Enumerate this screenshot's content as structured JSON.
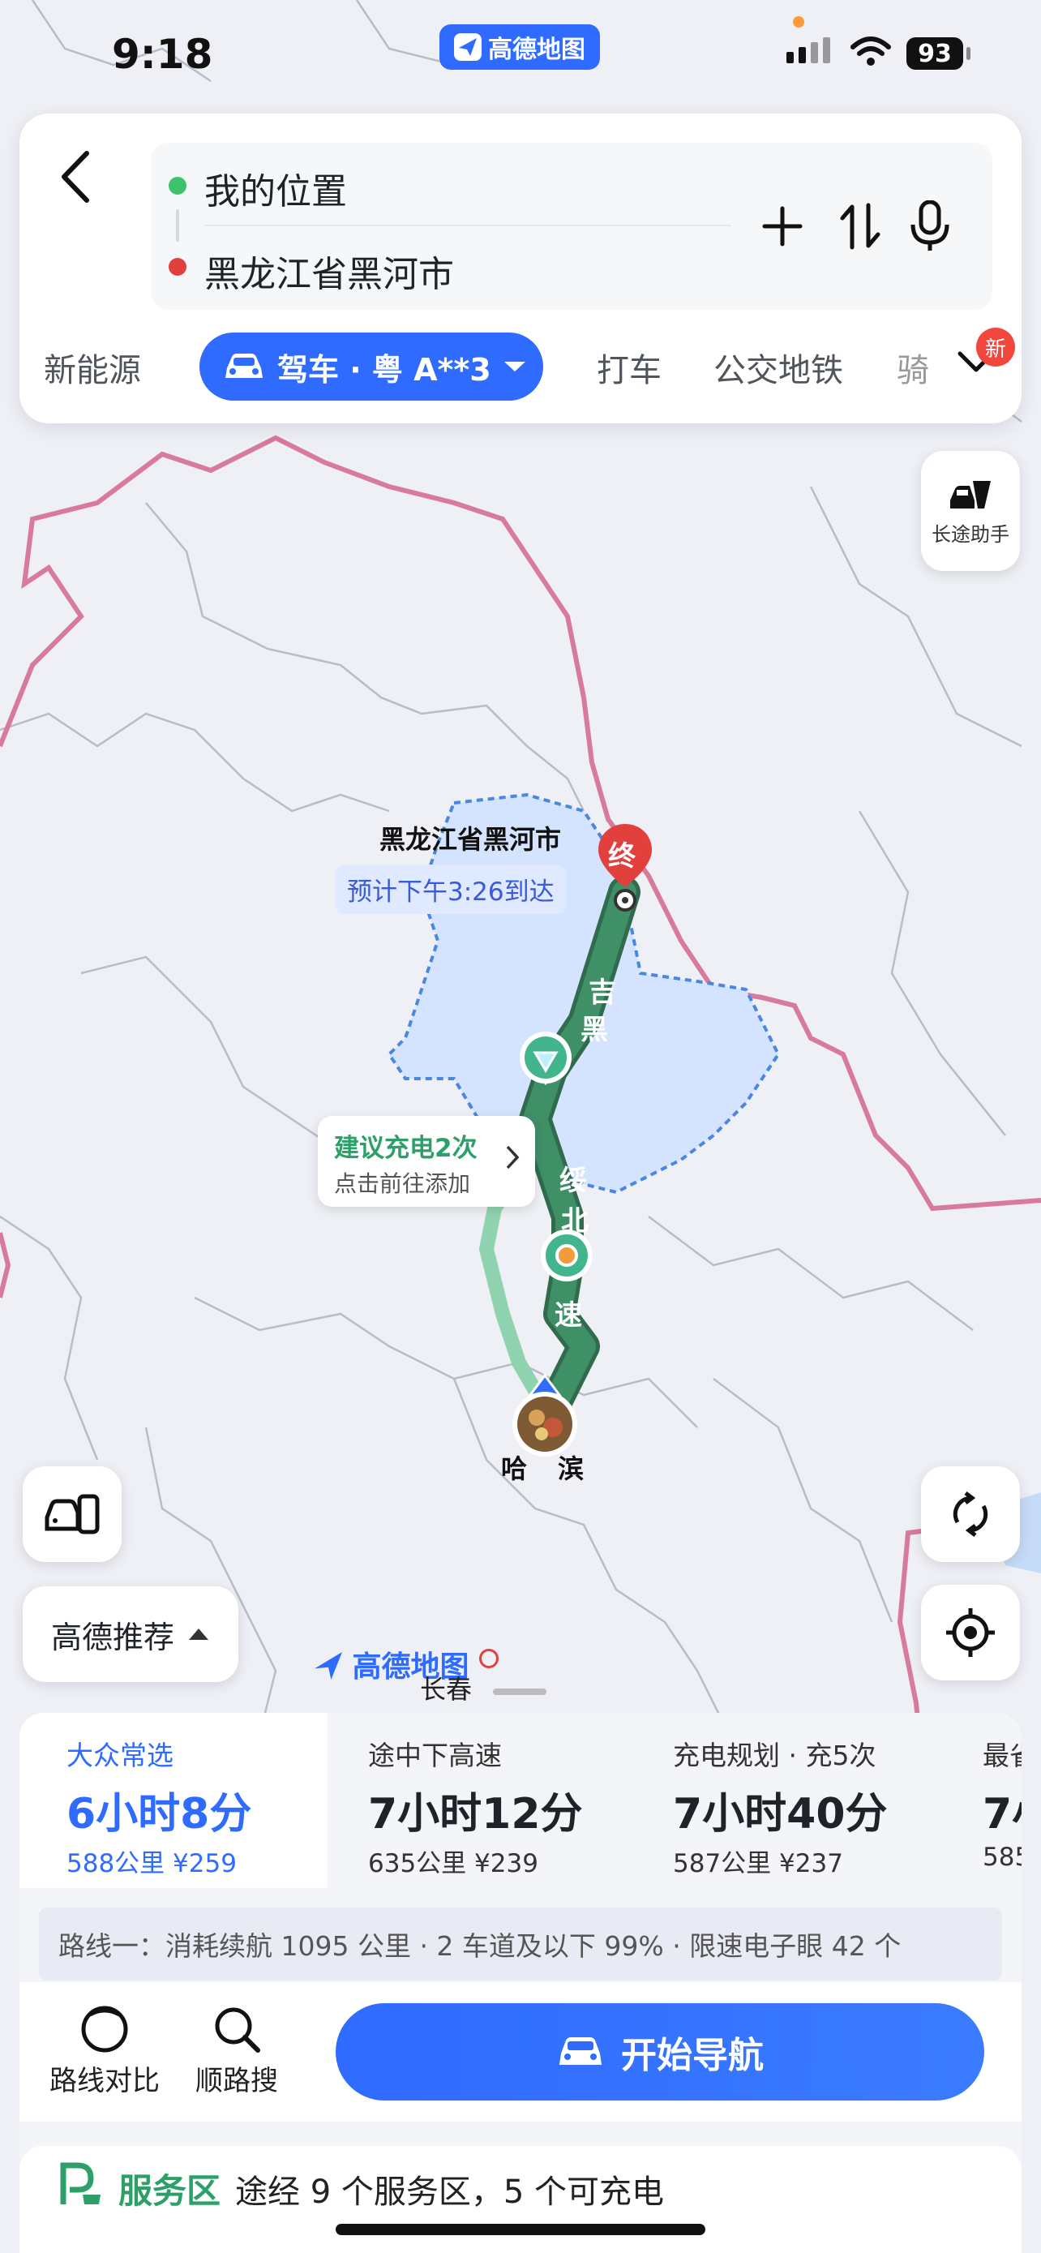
{
  "status": {
    "time": "9:18",
    "app_pill": "高德地图",
    "battery": "93"
  },
  "search": {
    "origin": "我的位置",
    "destination": "黑龙江省黑河市"
  },
  "modes": {
    "new_energy": "新能源",
    "drive": "驾车 · 粤 A**3",
    "taxi": "打车",
    "transit": "公交地铁",
    "ride": "骑",
    "new_badge": "新"
  },
  "map": {
    "long_trip_helper": "长途助手",
    "destination_label": "黑龙江省黑河市",
    "end_marker": "终",
    "eta": "预计下午3:26到达",
    "charge_tip_title": "建议充电2次",
    "charge_tip_sub": "点击前往添加",
    "road_chars": [
      "吉",
      "黑",
      "绥",
      "北",
      "速"
    ],
    "origin_city": "哈尔滨",
    "origin_partial_left": "哈",
    "origin_partial_right": "滨",
    "recommend_label": "高德推荐",
    "map_logo": "高德地图",
    "changchun": "长春"
  },
  "routes": [
    {
      "title": "大众常选",
      "time": "6小时8分",
      "meta": "588公里  ¥259",
      "selected": true
    },
    {
      "title": "途中下高速",
      "time": "7小时12分",
      "meta": "635公里  ¥239",
      "selected": false
    },
    {
      "title": "充电规划 · 充5次",
      "time": "7小时40分",
      "meta": "587公里  ¥237",
      "selected": false
    },
    {
      "title": "最省",
      "time": "7小",
      "meta": "585",
      "selected": false
    }
  ],
  "route_detail": "路线一：消耗续航 1095 公里 · 2 车道及以下 99% · 限速电子眼 42 个",
  "actions": {
    "compare": "路线对比",
    "along_search": "顺路搜",
    "start_nav": "开始导航"
  },
  "service": {
    "label": "服务区",
    "text": "途经 9 个服务区，5 个可充电"
  },
  "colors": {
    "brand_blue": "#2f6bff",
    "route_green": "#3a8a62",
    "alt_route": "#8fd3b0",
    "border_pink": "#d77a9c",
    "region_fill": "#d4e4ff"
  }
}
